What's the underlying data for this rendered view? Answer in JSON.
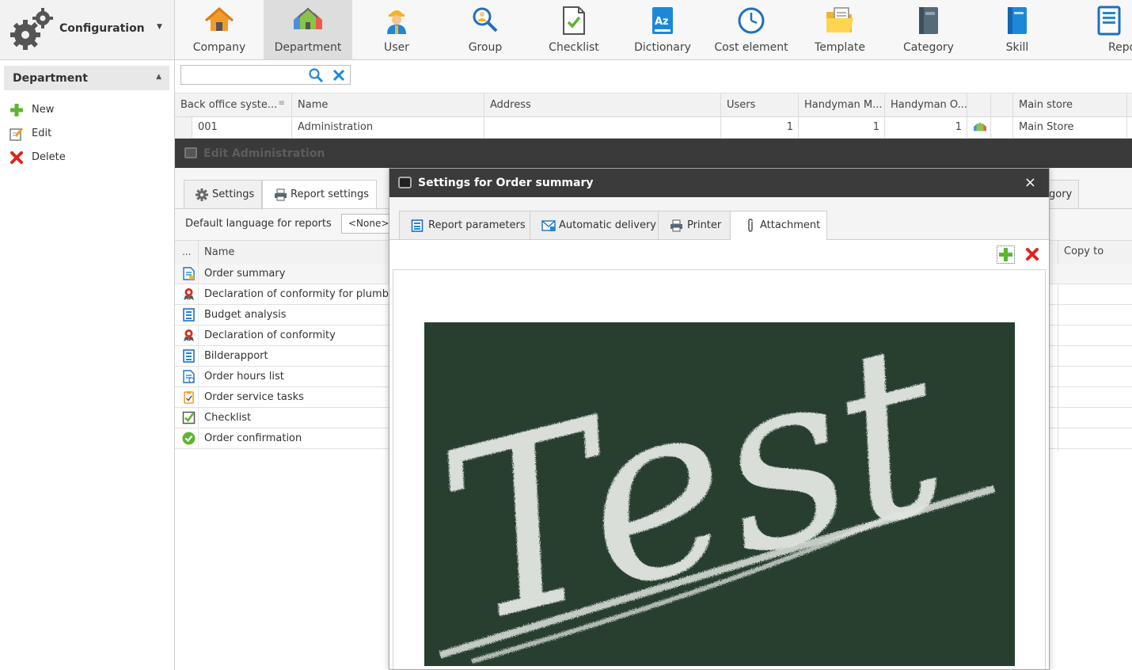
{
  "app": {
    "config_title": "Configuration"
  },
  "ribbon": {
    "items": [
      {
        "label": "Company",
        "icon": "house-icon"
      },
      {
        "label": "Department",
        "icon": "department-houses-icon",
        "active": true
      },
      {
        "label": "User",
        "icon": "worker-user-icon"
      },
      {
        "label": "Group",
        "icon": "group-search-icon"
      },
      {
        "label": "Checklist",
        "icon": "checklist-icon"
      },
      {
        "label": "Dictionary",
        "icon": "dictionary-icon"
      },
      {
        "label": "Cost element",
        "icon": "clock-icon"
      },
      {
        "label": "Template",
        "icon": "template-folder-icon"
      },
      {
        "label": "Category",
        "icon": "category-book-icon"
      },
      {
        "label": "Skill",
        "icon": "skill-book-icon"
      },
      {
        "label": "Reports",
        "icon": "reports-icon"
      }
    ]
  },
  "left_panel": {
    "header": "Department",
    "actions": [
      {
        "label": "New",
        "icon": "plus-icon"
      },
      {
        "label": "Edit",
        "icon": "edit-icon"
      },
      {
        "label": "Delete",
        "icon": "delete-x-icon"
      }
    ]
  },
  "search": {
    "value": "",
    "placeholder": ""
  },
  "grid": {
    "columns": [
      "Back office syste...",
      "Name",
      "Address",
      "Users",
      "Handyman M...",
      "Handyman O...",
      "",
      "Main store"
    ],
    "rows": [
      {
        "code": "001",
        "name": "Administration",
        "address": "",
        "users": "1",
        "handyman_m": "1",
        "handyman_o": "1",
        "main_store": "Main Store"
      }
    ]
  },
  "edit_window": {
    "title": "Edit Administration",
    "tabs": [
      "Settings",
      "Report settings"
    ],
    "category_tab_partial": "gory",
    "default_language_label": "Default language for reports",
    "default_language_value": "<None>",
    "reports_columns": {
      "dots": "...",
      "name": "Name",
      "copy_to": "Copy to"
    },
    "reports": [
      {
        "name": "Order summary",
        "icon": "report-doc-icon"
      },
      {
        "name": "Declaration of conformity for plumbers",
        "icon": "award-ribbon-icon"
      },
      {
        "name": "Budget analysis",
        "icon": "report-blue-icon"
      },
      {
        "name": "Declaration of conformity",
        "icon": "award-ribbon-icon"
      },
      {
        "name": "Bilderapport",
        "icon": "report-blue-icon"
      },
      {
        "name": "Order hours list",
        "icon": "report-doc-icon"
      },
      {
        "name": "Order service tasks",
        "icon": "clipboard-icon"
      },
      {
        "name": "Checklist",
        "icon": "check-box-icon"
      },
      {
        "name": "Order confirmation",
        "icon": "check-circle-icon"
      }
    ]
  },
  "dialog": {
    "title": "Settings for Order summary",
    "close": "×",
    "tabs": [
      {
        "label": "Report parameters",
        "icon": "report-params-icon"
      },
      {
        "label": "Automatic delivery",
        "icon": "mail-icon"
      },
      {
        "label": "Printer",
        "icon": "printer-icon"
      },
      {
        "label": "Attachment",
        "icon": "paperclip-icon",
        "active": true
      }
    ],
    "preview_text": "Test"
  },
  "colors": {
    "ribbon_active": "#dddddd",
    "dark_bar": "#3a3a3a",
    "green": "#5cb531",
    "red": "#e0241b",
    "blue": "#1e88d8",
    "chalkboard": "#2c4433"
  }
}
